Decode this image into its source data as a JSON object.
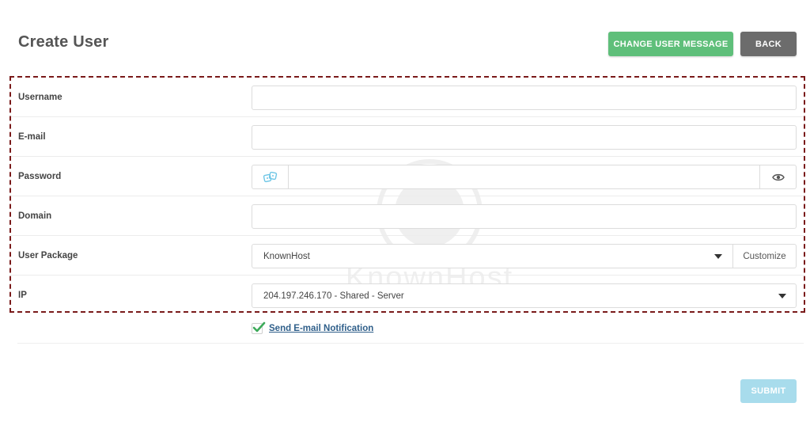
{
  "header": {
    "title": "Create User",
    "change_message_label": "CHANGE USER MESSAGE",
    "back_label": "BACK"
  },
  "form": {
    "username": {
      "label": "Username",
      "value": ""
    },
    "email": {
      "label": "E-mail",
      "value": ""
    },
    "password": {
      "label": "Password",
      "value": "",
      "generate_icon": "dice-icon",
      "toggle_icon": "eye-icon"
    },
    "domain": {
      "label": "Domain",
      "value": ""
    },
    "package": {
      "label": "User Package",
      "selected": "KnownHost",
      "customize_label": "Customize"
    },
    "ip": {
      "label": "IP",
      "selected": "204.197.246.170 - Shared - Server"
    }
  },
  "notification": {
    "label": "Send E-mail Notification",
    "checked": true
  },
  "footer": {
    "submit_label": "SUBMIT"
  },
  "watermark": {
    "text": "KnownHost"
  },
  "colors": {
    "change_button": "#5fbf7a",
    "back_button": "#6c6c6c",
    "submit_button": "#a8dcec",
    "highlight_border": "#7a1a1a",
    "link": "#2f5f8a",
    "check": "#3daa5a"
  }
}
